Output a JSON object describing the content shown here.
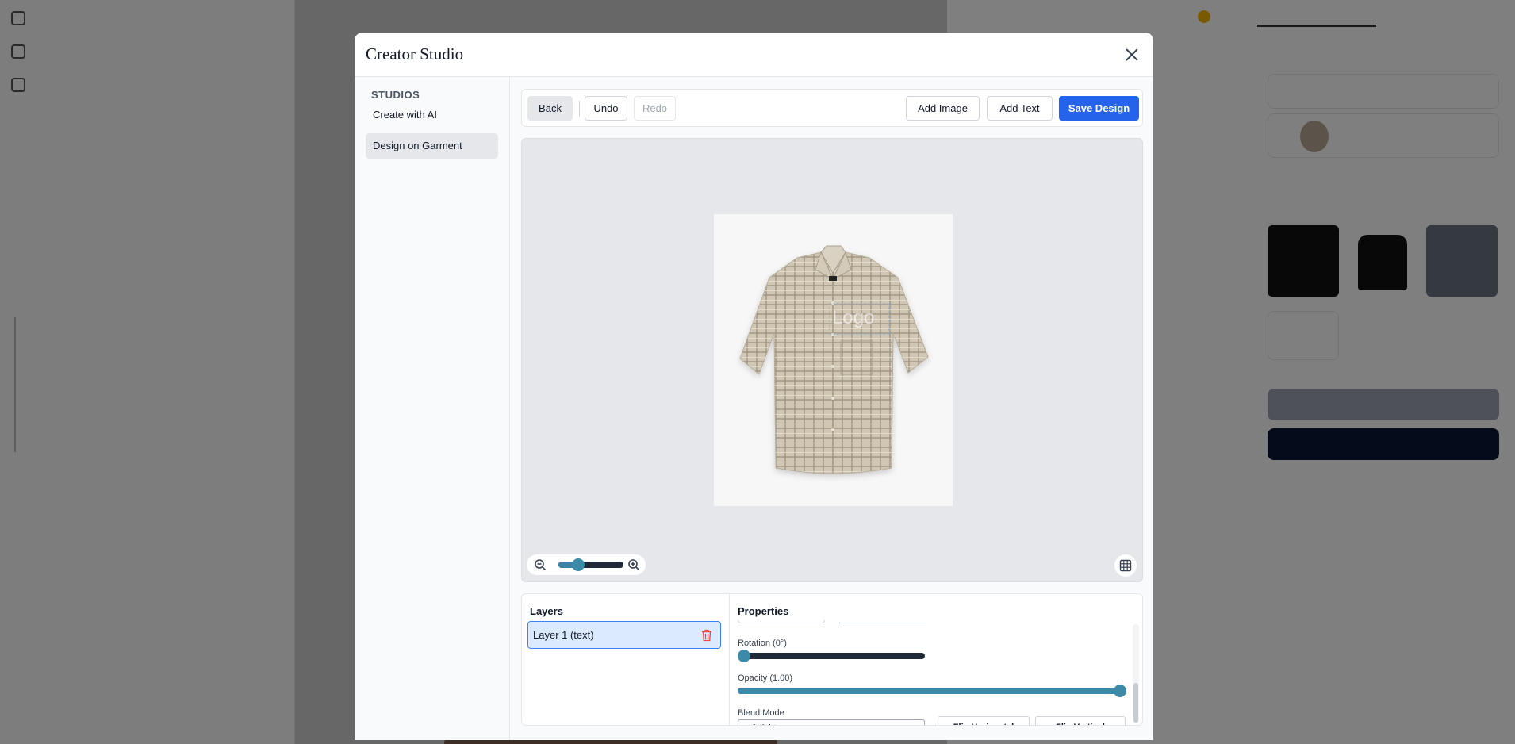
{
  "modal": {
    "title": "Creator Studio"
  },
  "sidebar": {
    "heading": "STUDIOS",
    "items": [
      {
        "label": "Create with AI",
        "active": false
      },
      {
        "label": "Design on Garment",
        "active": true
      }
    ]
  },
  "toolbar": {
    "back_label": "Back",
    "undo_label": "Undo",
    "redo_label": "Redo",
    "add_image_label": "Add Image",
    "add_text_label": "Add Text",
    "save_label": "Save Design"
  },
  "canvas": {
    "logo_text": "Logo",
    "zoom_level": 0.3
  },
  "layers": {
    "title": "Layers",
    "items": [
      {
        "label": "Layer 1 (text)",
        "selected": true
      }
    ]
  },
  "properties": {
    "title": "Properties",
    "rotation_label": "Rotation (0°)",
    "rotation_value": 0,
    "opacity_label": "Opacity (1.00)",
    "opacity_value": 1.0,
    "blend_mode_label": "Blend Mode",
    "blend_mode_value": "soft-light",
    "flip_horizontal_label": "Flip Horizontal",
    "flip_vertical_label": "Flip Vertical"
  },
  "colors": {
    "primary": "#2563eb",
    "slider_accent": "#3b8aa8",
    "danger": "#ef4444"
  }
}
